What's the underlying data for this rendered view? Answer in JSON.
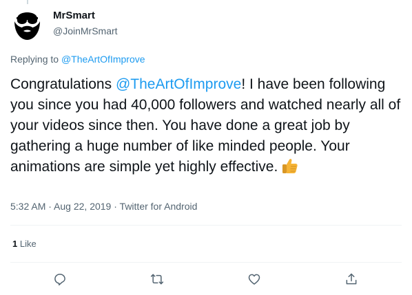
{
  "author": {
    "display_name": "MrSmart",
    "handle": "@JoinMrSmart",
    "avatar_icon": "bearded-man-sunglasses-avatar"
  },
  "reply": {
    "prefix": "Replying to",
    "mention": "@TheArtOfImprove"
  },
  "tweet": {
    "text_start": "Congratulations ",
    "mention": "@TheArtOfImprove",
    "text_rest": "! I have been following you since you had 40,000 followers and watched nearly all of your videos since then. You have done a great job by gathering a huge number of like minded people. Your animations are simple yet highly effective.",
    "emoji_icon": "thumbs-up-emoji"
  },
  "meta": {
    "time": "5:32 AM",
    "sep1": " · ",
    "date": "Aug 22, 2019",
    "sep2": " · ",
    "source": "Twitter for Android"
  },
  "stats": {
    "likes_count": "1",
    "likes_label": " Like"
  },
  "actions": {
    "reply_icon": "reply-icon",
    "retweet_icon": "retweet-icon",
    "like_icon": "heart-icon",
    "share_icon": "share-icon"
  },
  "colors": {
    "accent": "#1d9bf0",
    "text": "#0f1419",
    "secondary": "#536471",
    "divider": "#eff3f4"
  }
}
